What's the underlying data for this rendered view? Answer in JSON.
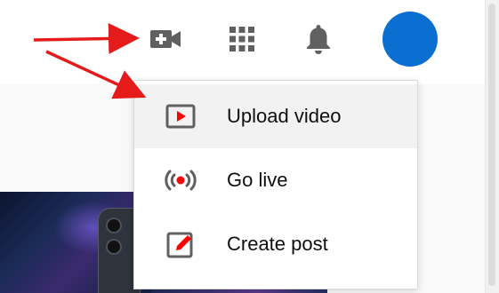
{
  "header": {
    "icons": [
      "create-video-icon",
      "apps-grid-icon",
      "notifications-bell-icon"
    ],
    "avatar_color": "#0a6fd1"
  },
  "create_menu": {
    "items": [
      {
        "label": "Upload video",
        "icon": "upload-video-icon"
      },
      {
        "label": "Go live",
        "icon": "go-live-icon"
      },
      {
        "label": "Create post",
        "icon": "create-post-icon"
      }
    ]
  },
  "annotation": {
    "arrow_color": "#e51b1b"
  },
  "colors": {
    "icon_gray": "#606060",
    "accent_red": "#ff0000"
  }
}
